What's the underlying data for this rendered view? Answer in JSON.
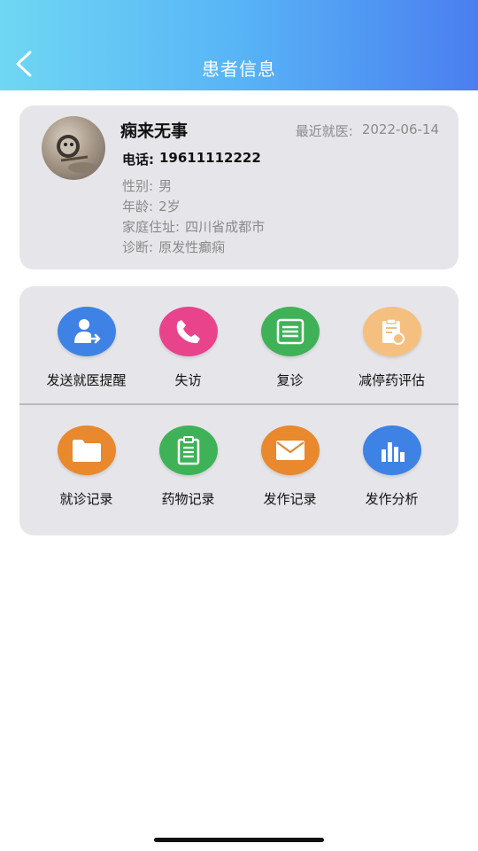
{
  "header": {
    "title": "患者信息",
    "back_icon": "chevron-left-icon"
  },
  "patient": {
    "name": "痫来无事",
    "last_visit_label": "最近就医:",
    "last_visit_date": "2022-06-14",
    "phone_label": "电话:",
    "phone": "19611112222",
    "gender_label": "性别:",
    "gender": "男",
    "age_label": "年龄:",
    "age": "2岁",
    "address_label": "家庭住址:",
    "address": "四川省成都市",
    "diagnosis_label": "诊断:",
    "diagnosis": "原发性癫痫"
  },
  "actions": {
    "row1": [
      {
        "label": "发送就医提醒",
        "icon": "user-send-icon",
        "color": "#3f82e6"
      },
      {
        "label": "失访",
        "icon": "phone-icon",
        "color": "#e9438c"
      },
      {
        "label": "复诊",
        "icon": "document-stack-icon",
        "color": "#3fb258"
      },
      {
        "label": "减停药评估",
        "icon": "clipboard-refresh-icon",
        "color": "#f5c07f"
      }
    ],
    "row2": [
      {
        "label": "就诊记录",
        "icon": "folder-icon",
        "color": "#e9882d"
      },
      {
        "label": "药物记录",
        "icon": "clipboard-icon",
        "color": "#3fb258"
      },
      {
        "label": "发作记录",
        "icon": "envelope-icon",
        "color": "#e9882d"
      },
      {
        "label": "发作分析",
        "icon": "bar-chart-icon",
        "color": "#3f82e6"
      }
    ]
  }
}
